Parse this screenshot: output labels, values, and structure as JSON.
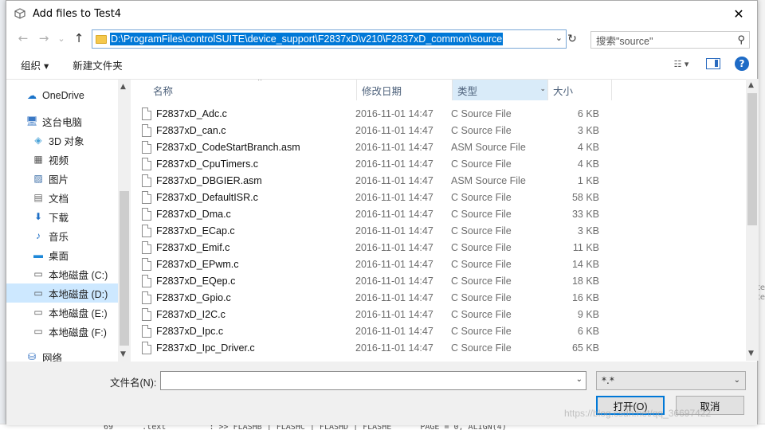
{
  "window": {
    "title": "Add files to Test4",
    "close_glyph": "✕"
  },
  "nav": {
    "back": "←",
    "forward": "→",
    "history": "⌄",
    "up": "↑",
    "address": "D:\\ProgramFiles\\controlSUITE\\device_support\\F2837xD\\v210\\F2837xD_common\\source",
    "refresh": "↻",
    "search_placeholder": "搜索\"source\"",
    "search_icon": "⚲"
  },
  "toolbar": {
    "organize": "组织 ▾",
    "new_folder": "新建文件夹",
    "view_glyph": "☷ ▾",
    "help": "?"
  },
  "sidebar": {
    "items": [
      {
        "label": "OneDrive",
        "icon": "onedrive-icon",
        "glyph": "☁",
        "color": "#1a73c9"
      },
      {
        "label": "这台电脑",
        "icon": "computer-icon",
        "glyph": "🖥",
        "color": "#3a78c4"
      },
      {
        "label": "3D 对象",
        "icon": "3d-objects-icon",
        "glyph": "◈",
        "color": "#4aa3d8"
      },
      {
        "label": "视频",
        "icon": "videos-icon",
        "glyph": "▦",
        "color": "#555"
      },
      {
        "label": "图片",
        "icon": "pictures-icon",
        "glyph": "▨",
        "color": "#3d6fa8"
      },
      {
        "label": "文档",
        "icon": "documents-icon",
        "glyph": "▤",
        "color": "#666"
      },
      {
        "label": "下载",
        "icon": "downloads-icon",
        "glyph": "⬇",
        "color": "#1e6fc6"
      },
      {
        "label": "音乐",
        "icon": "music-icon",
        "glyph": "♪",
        "color": "#1e6fc6"
      },
      {
        "label": "桌面",
        "icon": "desktop-icon",
        "glyph": "▬",
        "color": "#1e88d8"
      },
      {
        "label": "本地磁盘 (C:)",
        "icon": "drive-icon",
        "glyph": "▭",
        "color": "#555"
      },
      {
        "label": "本地磁盘 (D:)",
        "icon": "drive-icon",
        "glyph": "▭",
        "color": "#555"
      },
      {
        "label": "本地磁盘 (E:)",
        "icon": "drive-icon",
        "glyph": "▭",
        "color": "#555"
      },
      {
        "label": "本地磁盘 (F:)",
        "icon": "drive-icon",
        "glyph": "▭",
        "color": "#555"
      },
      {
        "label": "网络",
        "icon": "network-icon",
        "glyph": "⛁",
        "color": "#2a6bbf"
      }
    ],
    "scroll_up": "▲",
    "scroll_down": "▼"
  },
  "columns": {
    "name": "名称",
    "modified": "修改日期",
    "type": "类型",
    "size": "大小",
    "sort_caret": "^",
    "type_dropdown": "⌄"
  },
  "files": [
    {
      "name": "F2837xD_Adc.c",
      "date": "2016-11-01 14:47",
      "type": "C Source File",
      "size": "6 KB"
    },
    {
      "name": "F2837xD_can.c",
      "date": "2016-11-01 14:47",
      "type": "C Source File",
      "size": "3 KB"
    },
    {
      "name": "F2837xD_CodeStartBranch.asm",
      "date": "2016-11-01 14:47",
      "type": "ASM Source File",
      "size": "4 KB"
    },
    {
      "name": "F2837xD_CpuTimers.c",
      "date": "2016-11-01 14:47",
      "type": "C Source File",
      "size": "4 KB"
    },
    {
      "name": "F2837xD_DBGIER.asm",
      "date": "2016-11-01 14:47",
      "type": "ASM Source File",
      "size": "1 KB"
    },
    {
      "name": "F2837xD_DefaultISR.c",
      "date": "2016-11-01 14:47",
      "type": "C Source File",
      "size": "58 KB"
    },
    {
      "name": "F2837xD_Dma.c",
      "date": "2016-11-01 14:47",
      "type": "C Source File",
      "size": "33 KB"
    },
    {
      "name": "F2837xD_ECap.c",
      "date": "2016-11-01 14:47",
      "type": "C Source File",
      "size": "3 KB"
    },
    {
      "name": "F2837xD_Emif.c",
      "date": "2016-11-01 14:47",
      "type": "C Source File",
      "size": "11 KB"
    },
    {
      "name": "F2837xD_EPwm.c",
      "date": "2016-11-01 14:47",
      "type": "C Source File",
      "size": "14 KB"
    },
    {
      "name": "F2837xD_EQep.c",
      "date": "2016-11-01 14:47",
      "type": "C Source File",
      "size": "18 KB"
    },
    {
      "name": "F2837xD_Gpio.c",
      "date": "2016-11-01 14:47",
      "type": "C Source File",
      "size": "16 KB"
    },
    {
      "name": "F2837xD_I2C.c",
      "date": "2016-11-01 14:47",
      "type": "C Source File",
      "size": "9 KB"
    },
    {
      "name": "F2837xD_Ipc.c",
      "date": "2016-11-01 14:47",
      "type": "C Source File",
      "size": "6 KB"
    },
    {
      "name": "F2837xD_Ipc_Driver.c",
      "date": "2016-11-01 14:47",
      "type": "C Source File",
      "size": "65 KB"
    }
  ],
  "bottom": {
    "filename_label": "文件名(N):",
    "filename_value": "",
    "filter_value": "*.*",
    "dropdown_glyph": "⌄",
    "open_button": "打开(O)",
    "cancel_button": "取消"
  },
  "background": {
    "ide_text": "69      .text         : >> FLASHB | FLASHC | FLASHD | FLASHE      PAGE = 0, ALIGN(4)",
    "right_mark": "te\nte",
    "watermark": "https://blog.csdn.net/qq_36697422"
  }
}
